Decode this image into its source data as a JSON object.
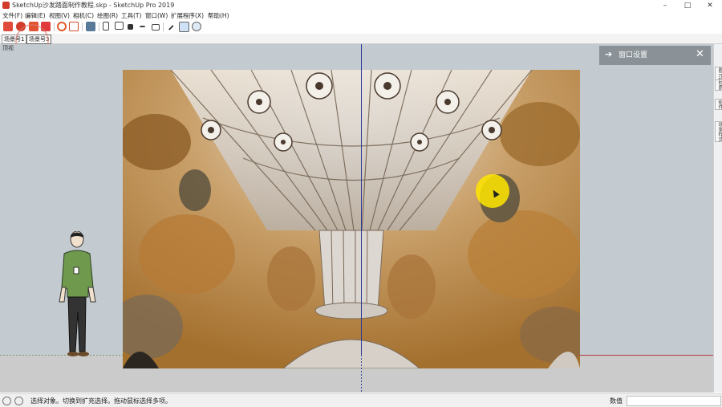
{
  "window": {
    "title": "SketchUp沙发踏面制作教程.skp - SketchUp Pro 2019",
    "minimize": "–",
    "maximize": "□",
    "close": "✕"
  },
  "menu": [
    "文件(F)",
    "编辑(E)",
    "视图(V)",
    "相机(C)",
    "绘图(R)",
    "工具(T)",
    "窗口(W)",
    "扩展程序(X)",
    "帮助(H)"
  ],
  "toolbar": {
    "icons": [
      "red-scene-icon",
      "gear-red-icon",
      "folder-red-icon",
      "camera-red-icon",
      "settings-icon",
      "building-icon",
      "print-icon",
      "front-view-icon",
      "box-view-icon",
      "solid-view-icon",
      "shaded-icon",
      "xray-icon",
      "resize-icon",
      "outliner-icon",
      "component-icon"
    ]
  },
  "scene_tabs": [
    "场景号1",
    "场景号3"
  ],
  "viewport": {
    "label": "顶视"
  },
  "panel": {
    "arrow": "➔",
    "title": "窗口设置",
    "close": "✕"
  },
  "tray_tabs": [
    "图元信息",
    "材质",
    "组件",
    "场景样式"
  ],
  "status": {
    "text": "选择对象。切换到扩充选择。拖动鼠标选择多项。",
    "measure_label": "数值",
    "measure_value": ""
  },
  "colors": {
    "sky": "#c3cbd0",
    "ground": "#cbcbcb",
    "panel": "#8a9297",
    "highlight": "#ffe600"
  }
}
